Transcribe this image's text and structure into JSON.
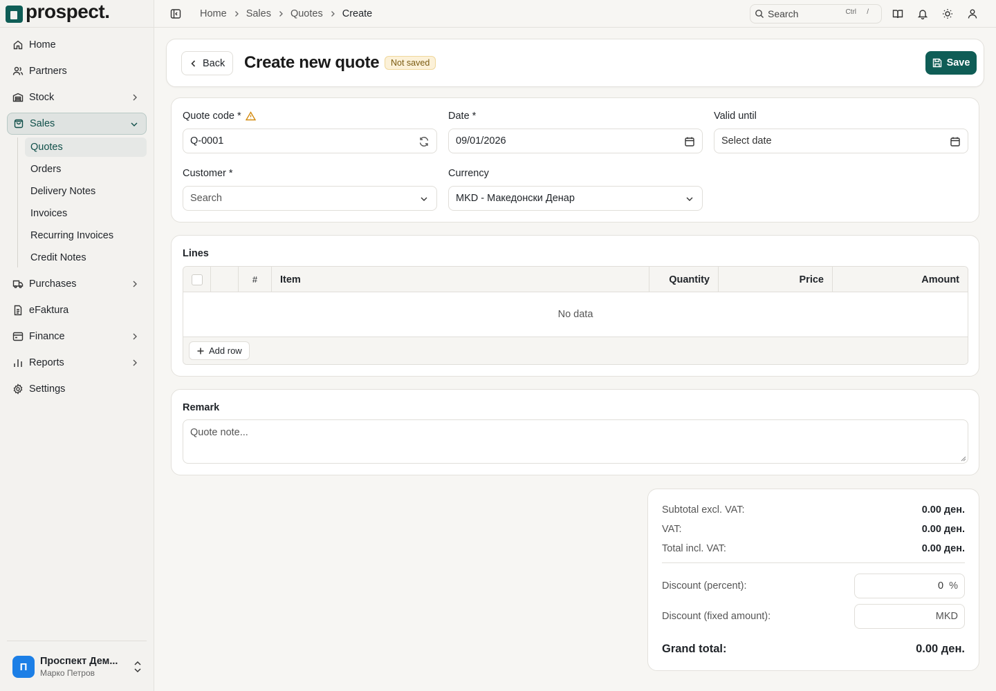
{
  "brand": {
    "name": "prospect.",
    "color": "#0f5d56"
  },
  "sidebar": {
    "items": [
      {
        "label": "Home",
        "icon": "home-icon"
      },
      {
        "label": "Partners",
        "icon": "users-icon"
      },
      {
        "label": "Stock",
        "icon": "warehouse-icon"
      },
      {
        "label": "Sales",
        "icon": "shopping-bag-icon"
      },
      {
        "label": "Purchases",
        "icon": "truck-icon"
      },
      {
        "label": "eFaktura",
        "icon": "document-icon"
      },
      {
        "label": "Finance",
        "icon": "wallet-icon"
      },
      {
        "label": "Reports",
        "icon": "bar-chart-icon"
      },
      {
        "label": "Settings",
        "icon": "gear-icon"
      }
    ],
    "sales_sub": [
      "Quotes",
      "Orders",
      "Delivery Notes",
      "Invoices",
      "Recurring Invoices",
      "Credit Notes"
    ]
  },
  "user": {
    "initial": "П",
    "company": "Проспект Дем...",
    "name": "Марко Петров",
    "avatar_color": "#1c7fe6"
  },
  "breadcrumb": [
    "Home",
    "Sales",
    "Quotes",
    "Create"
  ],
  "search": {
    "label": "Search",
    "kbd1": "Ctrl",
    "kbd2": "/"
  },
  "header": {
    "back": "Back",
    "title": "Create new quote",
    "status": "Not saved",
    "save": "Save"
  },
  "form": {
    "quote_code_label": "Quote code *",
    "quote_code_value": "Q-0001",
    "date_label": "Date *",
    "date_value": "09/01/2026",
    "valid_until_label": "Valid until",
    "valid_until_placeholder": "Select date",
    "customer_label": "Customer *",
    "customer_placeholder": "Search",
    "currency_label": "Currency",
    "currency_value": "MKD - Македонски Денар"
  },
  "lines": {
    "title": "Lines",
    "columns": {
      "num": "#",
      "item": "Item",
      "quantity": "Quantity",
      "price": "Price",
      "amount": "Amount"
    },
    "empty": "No data",
    "add_row": "Add row"
  },
  "remark": {
    "title": "Remark",
    "placeholder": "Quote note..."
  },
  "totals": {
    "subtotal_label": "Subtotal excl. VAT:",
    "subtotal_value": "0.00 ден.",
    "vat_label": "VAT:",
    "vat_value": "0.00 ден.",
    "total_label": "Total incl. VAT:",
    "total_value": "0.00 ден.",
    "discount_pct_label": "Discount (percent):",
    "discount_pct_value": "0",
    "discount_pct_unit": "%",
    "discount_fixed_label": "Discount (fixed amount):",
    "discount_fixed_unit": "MKD",
    "grand_label": "Grand total:",
    "grand_value": "0.00 ден."
  }
}
